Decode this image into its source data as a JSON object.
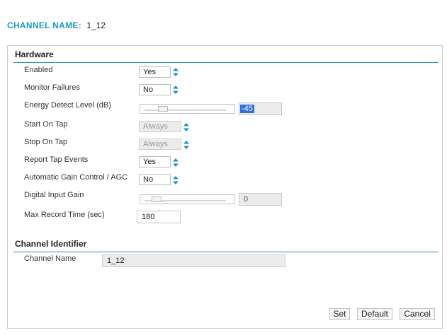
{
  "header": {
    "label": "CHANNEL NAME:",
    "value": "1_12"
  },
  "hardware": {
    "title": "Hardware",
    "enabled": {
      "label": "Enabled",
      "value": "Yes"
    },
    "monitor_failures": {
      "label": "Monitor Failures",
      "value": "No"
    },
    "energy_detect": {
      "label": "Energy Detect Level (dB)",
      "value": "-45"
    },
    "start_on_tap": {
      "label": "Start On Tap",
      "value": "Always"
    },
    "stop_on_tap": {
      "label": "Stop On Tap",
      "value": "Always"
    },
    "report_tap_events": {
      "label": "Report Tap Events",
      "value": "Yes"
    },
    "agc": {
      "label": "Automatic Gain Control / AGC",
      "value": "No"
    },
    "digital_input_gain": {
      "label": "Digital Input Gain",
      "value": "0"
    },
    "max_record_time": {
      "label": "Max Record Time (sec)",
      "value": "180"
    }
  },
  "channel_identifier": {
    "title": "Channel Identifier",
    "channel_name": {
      "label": "Channel Name",
      "value": "1_12"
    }
  },
  "buttons": {
    "set": "Set",
    "default": "Default",
    "cancel": "Cancel"
  },
  "colors": {
    "accent": "#1a9ac4",
    "rule": "#2a8fb9",
    "spinner": "#1e90c8",
    "selection": "#2f6fde"
  }
}
